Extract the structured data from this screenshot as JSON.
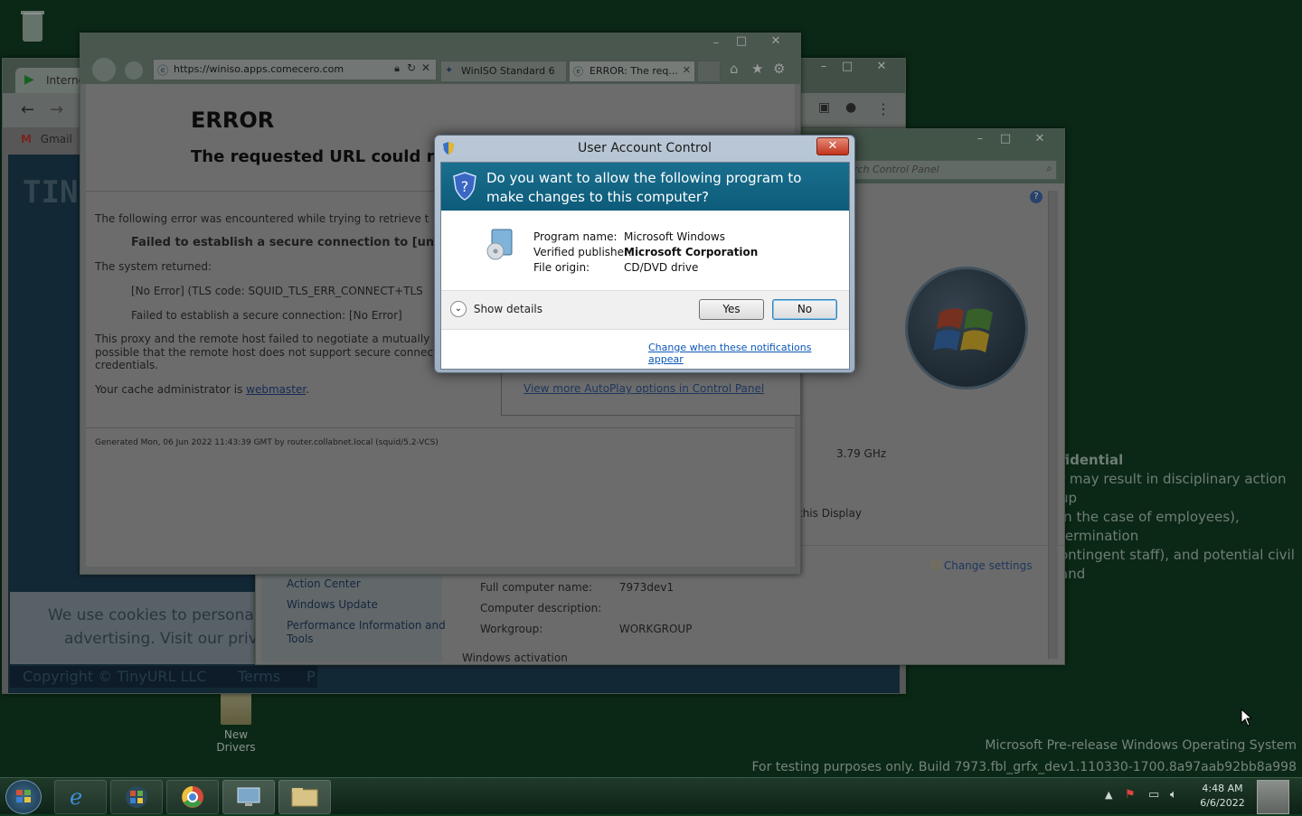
{
  "desktop": {
    "icons": [
      {
        "label": "New Drivers"
      }
    ],
    "watermark_line1": "Microsoft Pre-release Windows Operating System",
    "watermark_line2": "For testing purposes only. Build 7973.fbl_grfx_dev1.110330-1700.8a97aab92bb8a998",
    "confidential_title": "fidential",
    "confidential_lines": [
      "r may result in disciplinary action up",
      "in the case of employees), termination",
      "ontingent staff), and potential civil and"
    ]
  },
  "chrome_window": {
    "tab_label": "Interne",
    "bookmark": "Gmail",
    "logo_text": "TIN",
    "cookie_text_1": "We use cookies to personali",
    "cookie_text_2": "advertising. Visit our priva",
    "copyright": "Copyright © TinyURL LLC",
    "terms": "Terms",
    "p": "P"
  },
  "ie_window": {
    "url": "https://winiso.apps.comecero.com",
    "tab1": "WinISO Standard 6 ...",
    "tab2": "ERROR: The req...",
    "error_title": "ERROR",
    "error_subtitle": "The requested URL could n",
    "line1": "The following error was encountered while trying to retrieve t",
    "line2": "Failed to establish a secure connection to [unkno",
    "line3": "The system returned:",
    "line4": "[No Error] (TLS code: SQUID_TLS_ERR_CONNECT+TLS",
    "line5": "Failed to establish a secure connection: [No Error]",
    "line6a": "This proxy and the remote host failed to negotiate a mutually a",
    "line6b": "possible that the remote host does not support secure connect",
    "line6c": "credentials.",
    "admin_prefix": "Your cache administrator is ",
    "admin_link": "webmaster",
    "admin_suffix": ".",
    "generated": "Generated Mon, 06 Jun 2022 11:43:39 GMT by router.collabnet.local (squid/5.2-VCS)"
  },
  "autoplay_window": {
    "link": "View more AutoPlay options in Control Panel"
  },
  "system_window": {
    "search_placeholder": "rch Control Panel",
    "cpu": "3.79 GHz",
    "display": "this Display",
    "change_settings": "Change settings",
    "see_also": [
      "Action Center",
      "Windows Update",
      "Performance Information and",
      "Tools"
    ],
    "rows": [
      {
        "label": "Full computer name:",
        "value": "7973dev1"
      },
      {
        "label": "Computer description:",
        "value": ""
      },
      {
        "label": "Workgroup:",
        "value": "WORKGROUP"
      }
    ],
    "activation": "Windows activation"
  },
  "uac": {
    "title": "User Account Control",
    "question": "Do you want to allow the following program to make changes to this computer?",
    "program_name_label": "Program name:",
    "program_name": "Microsoft Windows",
    "publisher_label": "Verified publisher:",
    "publisher": "Microsoft Corporation",
    "origin_label": "File origin:",
    "origin": "CD/DVD drive",
    "show_details": "Show details",
    "yes": "Yes",
    "no": "No",
    "change_link": "Change when these notifications appear"
  },
  "taskbar": {
    "time": "4:48 AM",
    "date": "6/6/2022"
  }
}
